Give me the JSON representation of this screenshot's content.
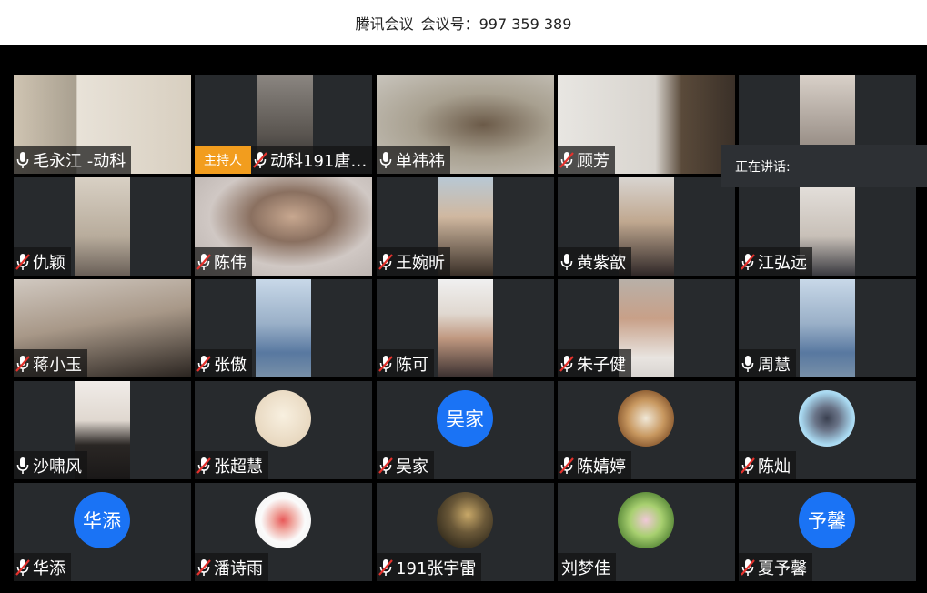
{
  "window": {
    "app_name": "腾讯会议",
    "meeting_label": "会议号：997 359 389"
  },
  "speaking_panel": {
    "label": "正在讲话:"
  },
  "host_badge": "主持人",
  "participants": [
    {
      "name": "毛永江 -动科",
      "mic": "on",
      "kind": "video"
    },
    {
      "name": "动科191唐…",
      "mic": "muted",
      "kind": "video",
      "host": true
    },
    {
      "name": "单祎祎",
      "mic": "on",
      "kind": "video"
    },
    {
      "name": "顾芳",
      "mic": "muted",
      "kind": "video"
    },
    {
      "name": "",
      "mic": "none",
      "kind": "video"
    },
    {
      "name": "仇颖",
      "mic": "muted",
      "kind": "video"
    },
    {
      "name": "陈伟",
      "mic": "muted",
      "kind": "video"
    },
    {
      "name": "王婉昕",
      "mic": "muted",
      "kind": "video"
    },
    {
      "name": "黄紫歆",
      "mic": "on",
      "kind": "video"
    },
    {
      "name": "江弘远",
      "mic": "muted",
      "kind": "video"
    },
    {
      "name": "蒋小玉",
      "mic": "muted",
      "kind": "video"
    },
    {
      "name": "张傲",
      "mic": "muted",
      "kind": "video"
    },
    {
      "name": "陈可",
      "mic": "muted",
      "kind": "video"
    },
    {
      "name": "朱子健",
      "mic": "muted",
      "kind": "video"
    },
    {
      "name": "周慧",
      "mic": "on",
      "kind": "video"
    },
    {
      "name": "沙啸风",
      "mic": "on",
      "kind": "video"
    },
    {
      "name": "张超慧",
      "mic": "muted",
      "kind": "avatar-image"
    },
    {
      "name": "吴家",
      "mic": "muted",
      "kind": "avatar-text",
      "avatar_text": "吴家"
    },
    {
      "name": "陈婧婷",
      "mic": "muted",
      "kind": "avatar-image"
    },
    {
      "name": "陈灿",
      "mic": "muted",
      "kind": "avatar-image"
    },
    {
      "name": "华添",
      "mic": "muted",
      "kind": "avatar-text",
      "avatar_text": "华添"
    },
    {
      "name": "潘诗雨",
      "mic": "muted",
      "kind": "avatar-image"
    },
    {
      "name": "191张宇雷",
      "mic": "muted",
      "kind": "avatar-image"
    },
    {
      "name": "刘梦佳",
      "mic": "none",
      "kind": "avatar-image"
    },
    {
      "name": "夏予馨",
      "mic": "muted",
      "kind": "avatar-text",
      "avatar_text": "予馨"
    }
  ],
  "colors": {
    "avatar_blue": "#1a73f5",
    "tile_bg": "#272a2d",
    "host_orange": "#f29d1e",
    "mute_red": "#e5322d"
  }
}
